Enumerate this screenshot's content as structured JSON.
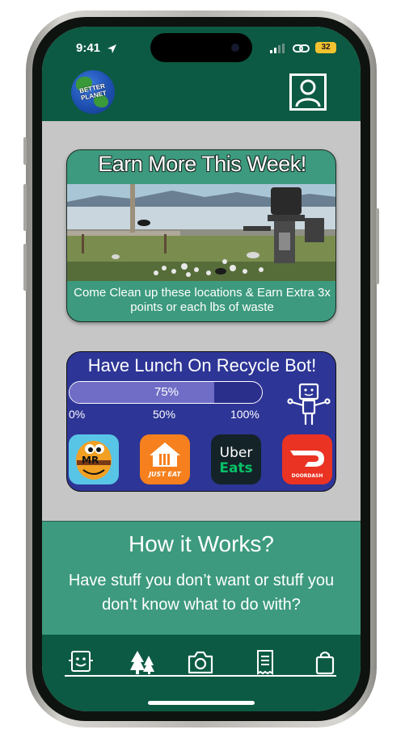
{
  "status_bar": {
    "time": "9:41",
    "battery": "32"
  },
  "header": {
    "logo_text": "BETTER PLANET",
    "profile_icon": "user-profile-icon"
  },
  "promo": {
    "title": "Earn More This Week!",
    "description": "Come Clean up these locations & Earn Extra 3x points or each lbs of waste"
  },
  "lunch": {
    "title": "Have Lunch On Recycle Bot!",
    "progress_percent": 75,
    "progress_label": "75%",
    "ticks": [
      "0%",
      "50%",
      "100%"
    ],
    "apps": [
      {
        "name": "mr-d-app-icon",
        "label": "MR"
      },
      {
        "name": "just-eat-app-icon",
        "label": "JUST EAT"
      },
      {
        "name": "uber-eats-app-icon",
        "label_top": "Uber",
        "label_bottom": "Eats"
      },
      {
        "name": "doordash-app-icon",
        "label": "DOORDASH"
      }
    ]
  },
  "how_it_works": {
    "title": "How it Works?",
    "text": "Have stuff you don’t want or stuff you don’t know what to do with?"
  },
  "nav": [
    "robot-icon",
    "trees-icon",
    "camera-icon",
    "receipt-icon",
    "shopping-bag-icon"
  ],
  "colors": {
    "header": "#0c5a43",
    "teal": "#3d9a7e",
    "indigo": "#2d3596"
  }
}
